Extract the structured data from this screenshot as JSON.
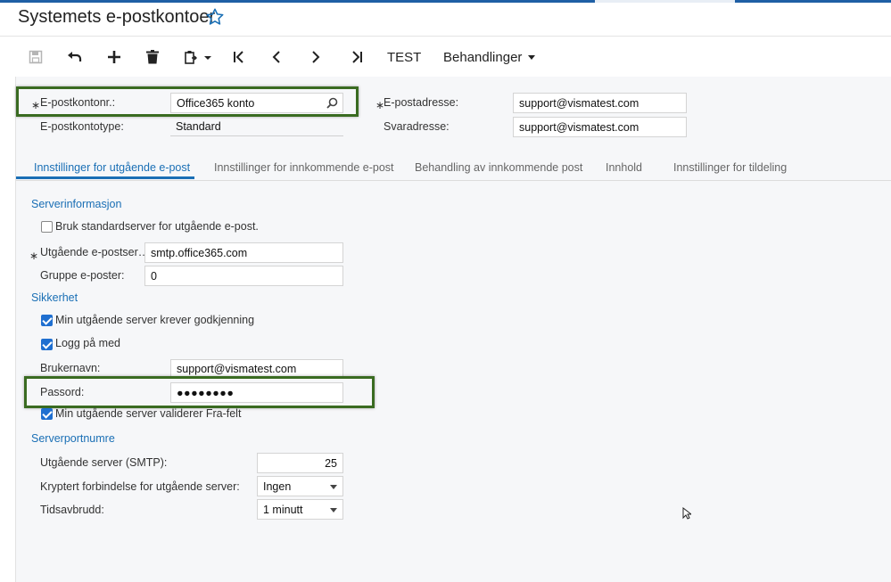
{
  "header": {
    "title": "Systemets e-postkontoer"
  },
  "toolbar": {
    "test_label": "TEST",
    "actions_label": "Behandlinger"
  },
  "summary": {
    "account_label": "E-postkontonr.:",
    "account_value": "Office365 konto",
    "type_label": "E-postkontotype:",
    "type_value": "Standard",
    "email_label": "E-postadresse:",
    "email_value": "support@vismatest.com",
    "reply_label": "Svaradresse:",
    "reply_value": "support@vismatest.com"
  },
  "tabs": [
    {
      "label": "Innstillinger for utgående e-post",
      "active": true
    },
    {
      "label": "Innstillinger for innkommende e-post",
      "active": false
    },
    {
      "label": "Behandling av innkommende post",
      "active": false
    },
    {
      "label": "Innhold",
      "active": false
    },
    {
      "label": "Innstillinger for tildeling",
      "active": false
    }
  ],
  "server_info": {
    "heading": "Serverinformasjon",
    "use_default_label": "Bruk standardserver for utgående e-post.",
    "use_default_checked": false,
    "outgoing_label": "Utgående e-postser…",
    "outgoing_value": "smtp.office365.com",
    "group_label": "Gruppe e-poster:",
    "group_value": "0"
  },
  "security": {
    "heading": "Sikkerhet",
    "auth_label": "Min utgående server krever godkjenning",
    "auth_checked": true,
    "login_label": "Logg på med",
    "login_checked": true,
    "username_label": "Brukernavn:",
    "username_value": "support@vismatest.com",
    "password_label": "Passord:",
    "password_value": "●●●●●●●●",
    "validate_label": "Min utgående server validerer Fra-felt",
    "validate_checked": true
  },
  "ports": {
    "heading": "Serverportnumre",
    "smtp_label": "Utgående server (SMTP):",
    "smtp_value": "25",
    "encrypt_label": "Kryptert forbindelse for utgående server:",
    "encrypt_value": "Ingen",
    "timeout_label": "Tidsavbrudd:",
    "timeout_value": "1 minutt"
  },
  "colors": {
    "accent": "#1a6fb5",
    "highlight": "#3a6b21",
    "checkbox": "#1f6fd0"
  }
}
